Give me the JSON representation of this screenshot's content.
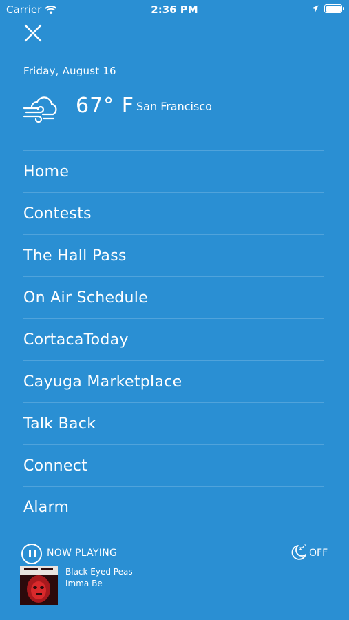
{
  "status_bar": {
    "carrier": "Carrier",
    "time": "2:36 PM"
  },
  "header": {
    "date": "Friday, August 16"
  },
  "weather": {
    "icon": "windy-cloud-icon",
    "temperature": "67° F",
    "city": "San Francisco"
  },
  "menu": {
    "items": [
      {
        "label": "Home"
      },
      {
        "label": "Contests"
      },
      {
        "label": "The Hall Pass"
      },
      {
        "label": "On Air Schedule"
      },
      {
        "label": "CortacaToday"
      },
      {
        "label": "Cayuga Marketplace"
      },
      {
        "label": "Talk Back"
      },
      {
        "label": "Connect"
      },
      {
        "label": "Alarm"
      }
    ]
  },
  "player": {
    "now_playing_label": "NOW PLAYING",
    "sleep_timer_label": "OFF",
    "artist": "Black Eyed Peas",
    "track": "Imma Be"
  },
  "colors": {
    "background": "#2a8fd3",
    "text": "#ffffff"
  }
}
